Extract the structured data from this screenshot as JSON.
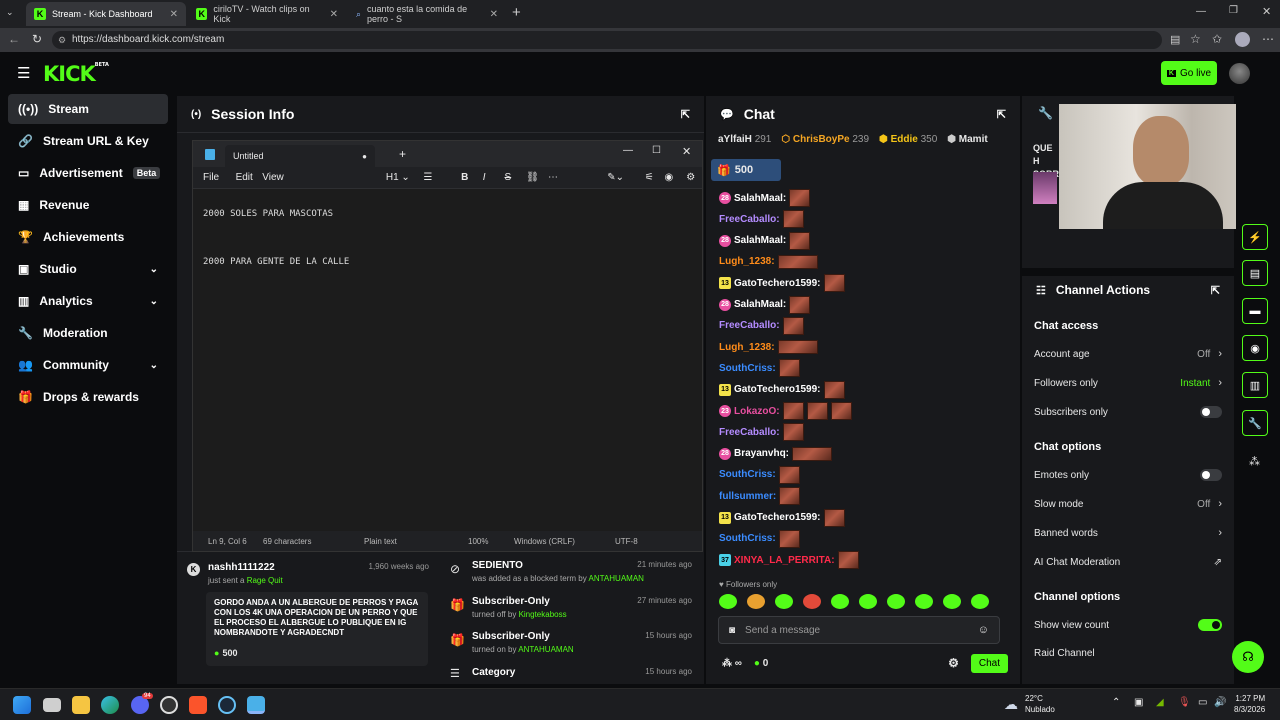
{
  "browser": {
    "tabs": [
      {
        "title": "Stream - Kick Dashboard"
      },
      {
        "title": "ciriloTV - Watch clips on Kick"
      },
      {
        "title": "cuanto esta la comida de perro - S"
      }
    ],
    "url": "https://dashboard.kick.com/stream"
  },
  "header": {
    "logo": "KICK",
    "logo_tag": "BETA",
    "go_live": "Go live"
  },
  "sidebar": {
    "items": [
      {
        "label": "Stream"
      },
      {
        "label": "Stream URL & Key"
      },
      {
        "label": "Advertisement",
        "badge": "Beta"
      },
      {
        "label": "Revenue"
      },
      {
        "label": "Achievements"
      },
      {
        "label": "Studio"
      },
      {
        "label": "Analytics"
      },
      {
        "label": "Moderation"
      },
      {
        "label": "Community"
      },
      {
        "label": "Drops & rewards"
      }
    ]
  },
  "session": {
    "title": "Session Info"
  },
  "notepad": {
    "tab_title": "Untitled",
    "menu": [
      "File",
      "Edit",
      "View"
    ],
    "heading": "H1",
    "lines": [
      "2000 SOLES PARA MASCOTAS",
      "2000 PARA GENTE DE LA CALLE"
    ],
    "status": {
      "position": "Ln 9, Col 6",
      "chars": "69 characters",
      "format": "Plain text",
      "zoom": "100%",
      "eol": "Windows (CRLF)",
      "encoding": "UTF-8"
    }
  },
  "activity_left": {
    "user": "nashh1111222",
    "time": "1,960 weeks ago",
    "action": "just sent a",
    "item": "Rage Quit",
    "message": "GORDO ANDA A UN ALBERGUE DE PERROS Y PAGA CON LOS 4K UNA OPERACION DE UN PERRO Y QUE EL PROCESO EL ALBERGUE LO PUBLIQUE EN IG NOMBRANDOTE Y AGRADECNDT",
    "amount": "500"
  },
  "activity_right": [
    {
      "title": "SEDIENTO",
      "time": "21 minutes ago",
      "desc": "was added as a blocked term by",
      "user": "ANTAHUAMAN"
    },
    {
      "title": "Subscriber-Only",
      "time": "27 minutes ago",
      "desc": "turned off by",
      "user": "Kingtekaboss"
    },
    {
      "title": "Subscriber-Only",
      "time": "15 hours ago",
      "desc": "turned on by",
      "user": "ANTAHUAMAN"
    },
    {
      "title": "Category",
      "time": "15 hours ago",
      "desc": "",
      "user": ""
    }
  ],
  "chat": {
    "title": "Chat",
    "leaderboard": [
      {
        "name": "aYlfaiH",
        "points": "291"
      },
      {
        "name": "ChrisBoyPe",
        "points": "239"
      },
      {
        "name": "Eddie",
        "points": "350"
      },
      {
        "name": "Mamit",
        "points": ""
      }
    ],
    "pinned_amount": "500",
    "messages": [
      {
        "badge": "28",
        "user": "SalahMaal:",
        "color": "#ffffff",
        "emotes": 1,
        "badge_type": "pink"
      },
      {
        "badge": "",
        "user": "FreeCaballo:",
        "color": "#b48cff",
        "emotes": 1,
        "badge_type": ""
      },
      {
        "badge": "28",
        "user": "SalahMaal:",
        "color": "#ffffff",
        "emotes": 1,
        "badge_type": "pink"
      },
      {
        "badge": "",
        "user": "Lugh_1238:",
        "color": "#ff8c1a",
        "emotes": 1,
        "badge_type": "",
        "wide": true
      },
      {
        "badge": "13",
        "user": "GatoTechero1599:",
        "color": "#ffffff",
        "emotes": 1,
        "badge_type": "yel"
      },
      {
        "badge": "28",
        "user": "SalahMaal:",
        "color": "#ffffff",
        "emotes": 1,
        "badge_type": "pink"
      },
      {
        "badge": "",
        "user": "FreeCaballo:",
        "color": "#b48cff",
        "emotes": 1,
        "badge_type": ""
      },
      {
        "badge": "",
        "user": "Lugh_1238:",
        "color": "#ff8c1a",
        "emotes": 1,
        "badge_type": "",
        "wide": true
      },
      {
        "badge": "",
        "user": "SouthCriss:",
        "color": "#3b8cff",
        "emotes": 1,
        "badge_type": ""
      },
      {
        "badge": "13",
        "user": "GatoTechero1599:",
        "color": "#ffffff",
        "emotes": 1,
        "badge_type": "yel"
      },
      {
        "badge": "23",
        "user": "LokazoO:",
        "color": "#e84fa0",
        "emotes": 3,
        "badge_type": "pink"
      },
      {
        "badge": "",
        "user": "FreeCaballo:",
        "color": "#b48cff",
        "emotes": 1,
        "badge_type": ""
      },
      {
        "badge": "28",
        "user": "Brayanvhq:",
        "color": "#ffffff",
        "emotes": 1,
        "badge_type": "pink",
        "wide": true
      },
      {
        "badge": "",
        "user": "SouthCriss:",
        "color": "#3b8cff",
        "emotes": 1,
        "badge_type": ""
      },
      {
        "badge": "",
        "user": "fullsummer:",
        "color": "#3b8cff",
        "emotes": 1,
        "badge_type": ""
      },
      {
        "badge": "13",
        "user": "GatoTechero1599:",
        "color": "#ffffff",
        "emotes": 1,
        "badge_type": "yel"
      },
      {
        "badge": "",
        "user": "SouthCriss:",
        "color": "#3b8cff",
        "emotes": 1,
        "badge_type": ""
      },
      {
        "badge": "37",
        "user": "XINYA_LA_PERRITA:",
        "color": "#ff2a4a",
        "emotes": 1,
        "badge_type": "cyan"
      }
    ],
    "followers_only": "Followers only",
    "input_placeholder": "Send a message",
    "count": "0",
    "send": "Chat"
  },
  "pinned_card": {
    "text": "QUE H SOBR"
  },
  "channel_actions": {
    "title": "Channel Actions",
    "chat_access": "Chat access",
    "account_age": {
      "label": "Account age",
      "value": "Off"
    },
    "followers_only": {
      "label": "Followers only",
      "value": "Instant"
    },
    "subscribers_only": {
      "label": "Subscribers only",
      "on": false
    },
    "chat_options": "Chat options",
    "emotes_only": {
      "label": "Emotes only",
      "on": false
    },
    "slow_mode": {
      "label": "Slow mode",
      "value": "Off"
    },
    "banned_words": {
      "label": "Banned words"
    },
    "ai_moderation": {
      "label": "AI Chat Moderation"
    },
    "channel_options": "Channel options",
    "show_view_count": {
      "label": "Show view count",
      "on": true
    },
    "raid": {
      "label": "Raid Channel"
    }
  },
  "taskbar": {
    "weather_temp": "22°C",
    "weather_desc": "Nublado",
    "time": "1:27 PM",
    "date": "8/3/2026",
    "notif_count": "94"
  },
  "colors": {
    "accent": "#53fc18",
    "panel": "#18191c",
    "bg": "#0b0c0e"
  }
}
